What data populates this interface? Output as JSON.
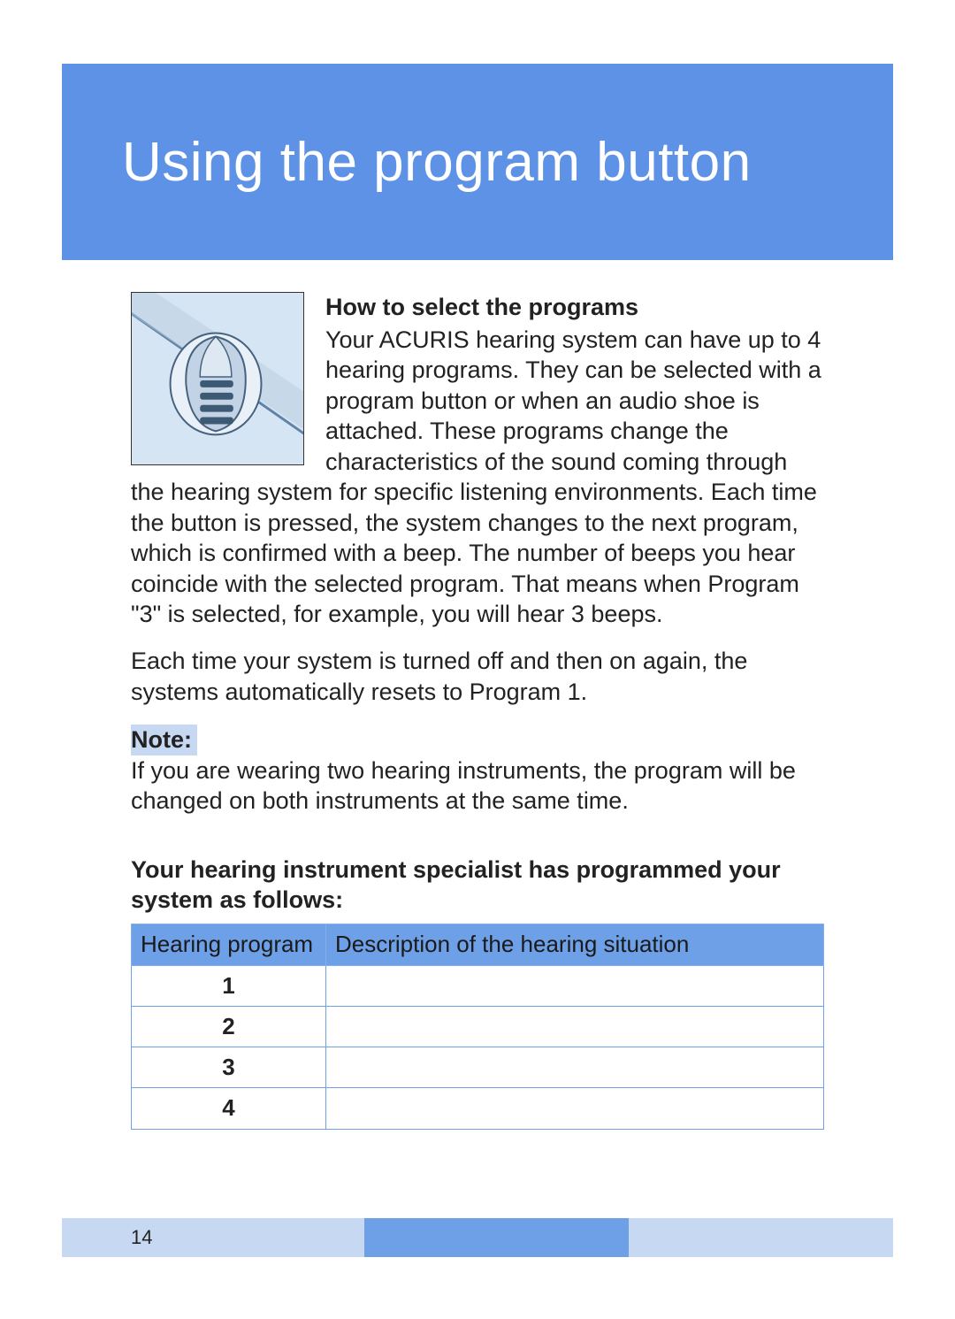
{
  "title": "Using the program button",
  "section_heading": "How to select the programs",
  "paragraph1": "Your ACURIS hearing system can have up to 4 hearing programs. They can be selected with a program button or when an audio shoe is attached. These programs change the characteristics of the sound coming through the hearing system for specific listening environments. Each time the button is pressed, the system changes to the next program, which is confirmed with a beep. The number of beeps you hear coincide with the selected program. That means when Program \"3\" is selected, for example, you will hear 3 beeps.",
  "paragraph2": "Each time your system is turned off and then on again, the systems automatically resets to Program 1.",
  "note_label": "Note:",
  "note_text": "If you are wearing two hearing instruments, the program will be changed on both instruments at the same time.",
  "specialist_heading": "Your hearing instrument specialist has programmed your system as follows:",
  "table": {
    "header_program": "Hearing program",
    "header_description": "Description of the hearing situation",
    "rows": [
      {
        "num": "1",
        "desc": ""
      },
      {
        "num": "2",
        "desc": ""
      },
      {
        "num": "3",
        "desc": ""
      },
      {
        "num": "4",
        "desc": ""
      }
    ]
  },
  "page_number": "14"
}
